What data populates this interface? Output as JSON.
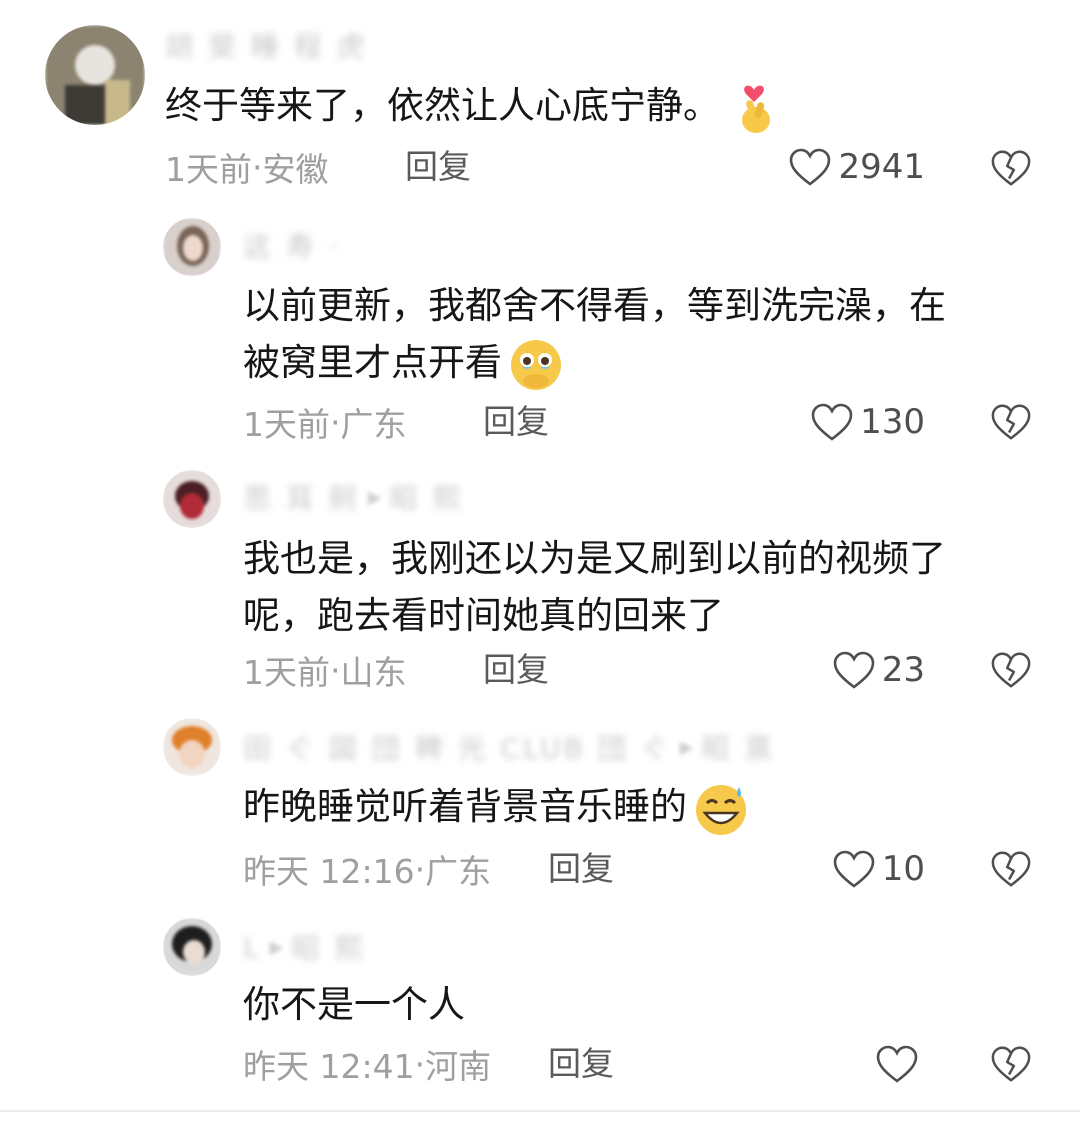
{
  "comments": [
    {
      "author": "胡 斐 睡 程 虎",
      "text": "终于等来了，依然让人心底宁静。",
      "emoji": "finger-heart-emoji",
      "time": "1天前",
      "location": "安徽",
      "reply_label": "回复",
      "likes": "2941"
    },
    {
      "author": "这 寿 ·",
      "badge": "",
      "line1": "以前更新，我都舍不得看，等到洗完澡，在",
      "line2": "被窝里才点开看",
      "emoji": "holding-back-tears-emoji",
      "time": "1天前",
      "location": "广东",
      "reply_label": "回复",
      "likes": "130"
    },
    {
      "author": "思 耳 舸",
      "badge": "昭 熙",
      "line1": "我也是，我刚还以为是又刷到以前的视频了",
      "line2": "呢，跑去看时间她真的回来了",
      "time": "1天前",
      "location": "山东",
      "reply_label": "回复",
      "likes": "23"
    },
    {
      "author": "田 ぐ 図 団 稗 光 CLUB 団 ぐ",
      "badge": "昭 禀",
      "text": "昨晚睡觉听着背景音乐睡的",
      "emoji": "grinning-sweat-emoji",
      "time": "昨天 12:16",
      "location": "广东",
      "reply_label": "回复",
      "likes": "10"
    },
    {
      "author": "L",
      "badge": "昭 熙",
      "text": "你不是一个人",
      "time": "昨天 12:41",
      "location": "河南",
      "reply_label": "回复",
      "likes": ""
    }
  ],
  "meta_separator": " · ",
  "colors": {
    "text": "#161616",
    "meta": "#9f9f9f",
    "reply": "#5a5a5a",
    "icon": "#4f4f4f"
  }
}
